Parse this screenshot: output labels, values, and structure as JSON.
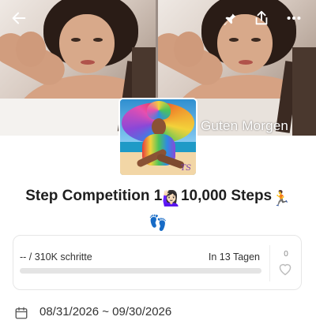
{
  "cover": {
    "overlay_text": "Guten Morgen"
  },
  "icons": {
    "back": "arrow-left-icon",
    "pin": "pin-icon",
    "share": "share-icon",
    "more": "more-dots-icon",
    "calendar": "calendar-icon",
    "heart": "heart-icon"
  },
  "avatar": {
    "signature": "TS"
  },
  "competition": {
    "title_part1": "Step Competition 1",
    "title_part2": "10,000 Steps",
    "emoji_1": "🙋🏻‍♀️",
    "emoji_2": "🏃",
    "emoji_3": "👣"
  },
  "progress": {
    "steps_text": "-- / 310K schritte",
    "remaining_text": "In 13 Tagen",
    "fraction": 0,
    "likes_count": "0"
  },
  "dates": {
    "range": "08/31/2026 ~ 09/30/2026"
  },
  "colors": {
    "progress_fill": "#7fd16c",
    "progress_track": "#e4e4e4",
    "title": "#1f1f1f"
  }
}
